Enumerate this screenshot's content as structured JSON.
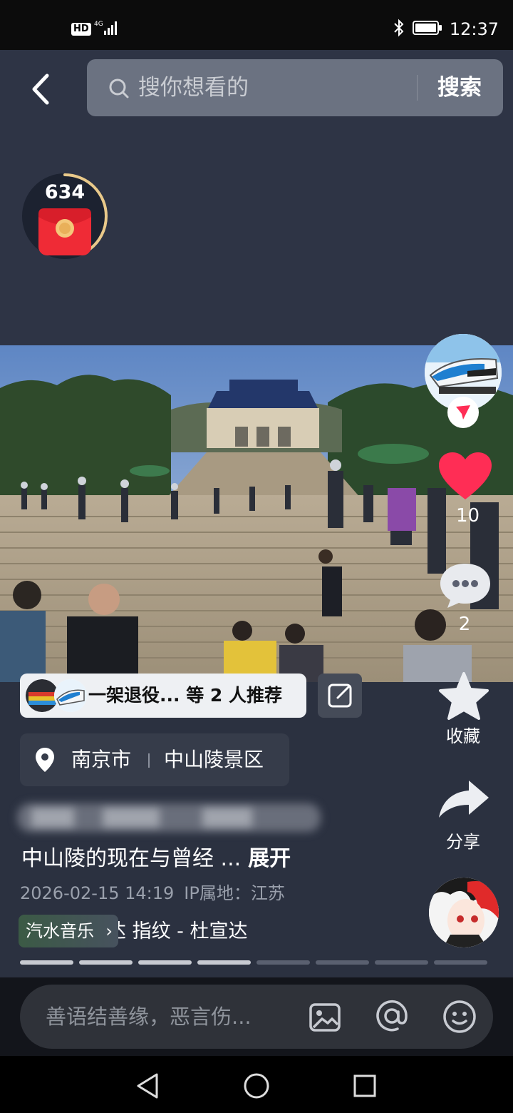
{
  "status_bar": {
    "network_badge": "HD",
    "network_type": "4G",
    "time": "12:37",
    "icons": [
      "signal-icon",
      "bluetooth-icon",
      "battery-icon"
    ]
  },
  "header": {
    "back_icon": "back-chevron-icon",
    "search": {
      "placeholder": "搜你想看的",
      "button_label": "搜索"
    }
  },
  "red_packet": {
    "count": "634",
    "progress": 0.4,
    "icon": "red-packet-icon"
  },
  "right_rail": {
    "like_count": "10",
    "comment_count": "2",
    "favorite_label": "收藏",
    "share_label": "分享"
  },
  "recommend": {
    "text": "一架退役... 等 2 人推荐"
  },
  "location": {
    "city": "南京市",
    "place": "中山陵景区"
  },
  "caption": {
    "text": "中山陵的现在与曾经 ...",
    "expand_label": "展开"
  },
  "meta": {
    "datetime": "2026-02-15 14:19",
    "ip_location": "IP属地：江苏"
  },
  "music": {
    "app_label": "汽水音乐",
    "track": "杜宣达   指纹 - 杜宣达"
  },
  "progress": {
    "total_segments": 8,
    "completed_segments": 4
  },
  "comment_bar": {
    "placeholder": "善语结善缘，恶言伤..."
  },
  "colors": {
    "background": "#2b3140",
    "like_red": "#ff2d55",
    "search_bg": "#6b7281"
  }
}
